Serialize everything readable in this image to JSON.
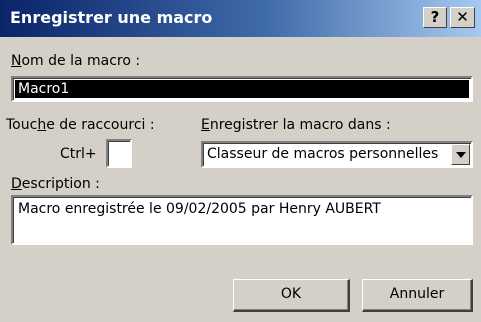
{
  "dialog": {
    "title": "Enregistrer une macro",
    "help_glyph": "?",
    "close_glyph": "✕"
  },
  "macro_name": {
    "label_underlined": "N",
    "label_rest": "om de la macro :",
    "value": "Macro1"
  },
  "shortcut": {
    "label_pre": "Touc",
    "label_underlined": "h",
    "label_post": "e de raccourci :",
    "prefix": "Ctrl+",
    "value": ""
  },
  "store_in": {
    "label_underlined": "E",
    "label_rest": "nregistrer la macro dans :",
    "selected": "Classeur de macros personnelles"
  },
  "description": {
    "label_underlined": "D",
    "label_rest": "escription :",
    "value": "Macro enregistrée le 09/02/2005 par Henry AUBERT"
  },
  "buttons": {
    "ok": "OK",
    "cancel": "Annuler"
  }
}
